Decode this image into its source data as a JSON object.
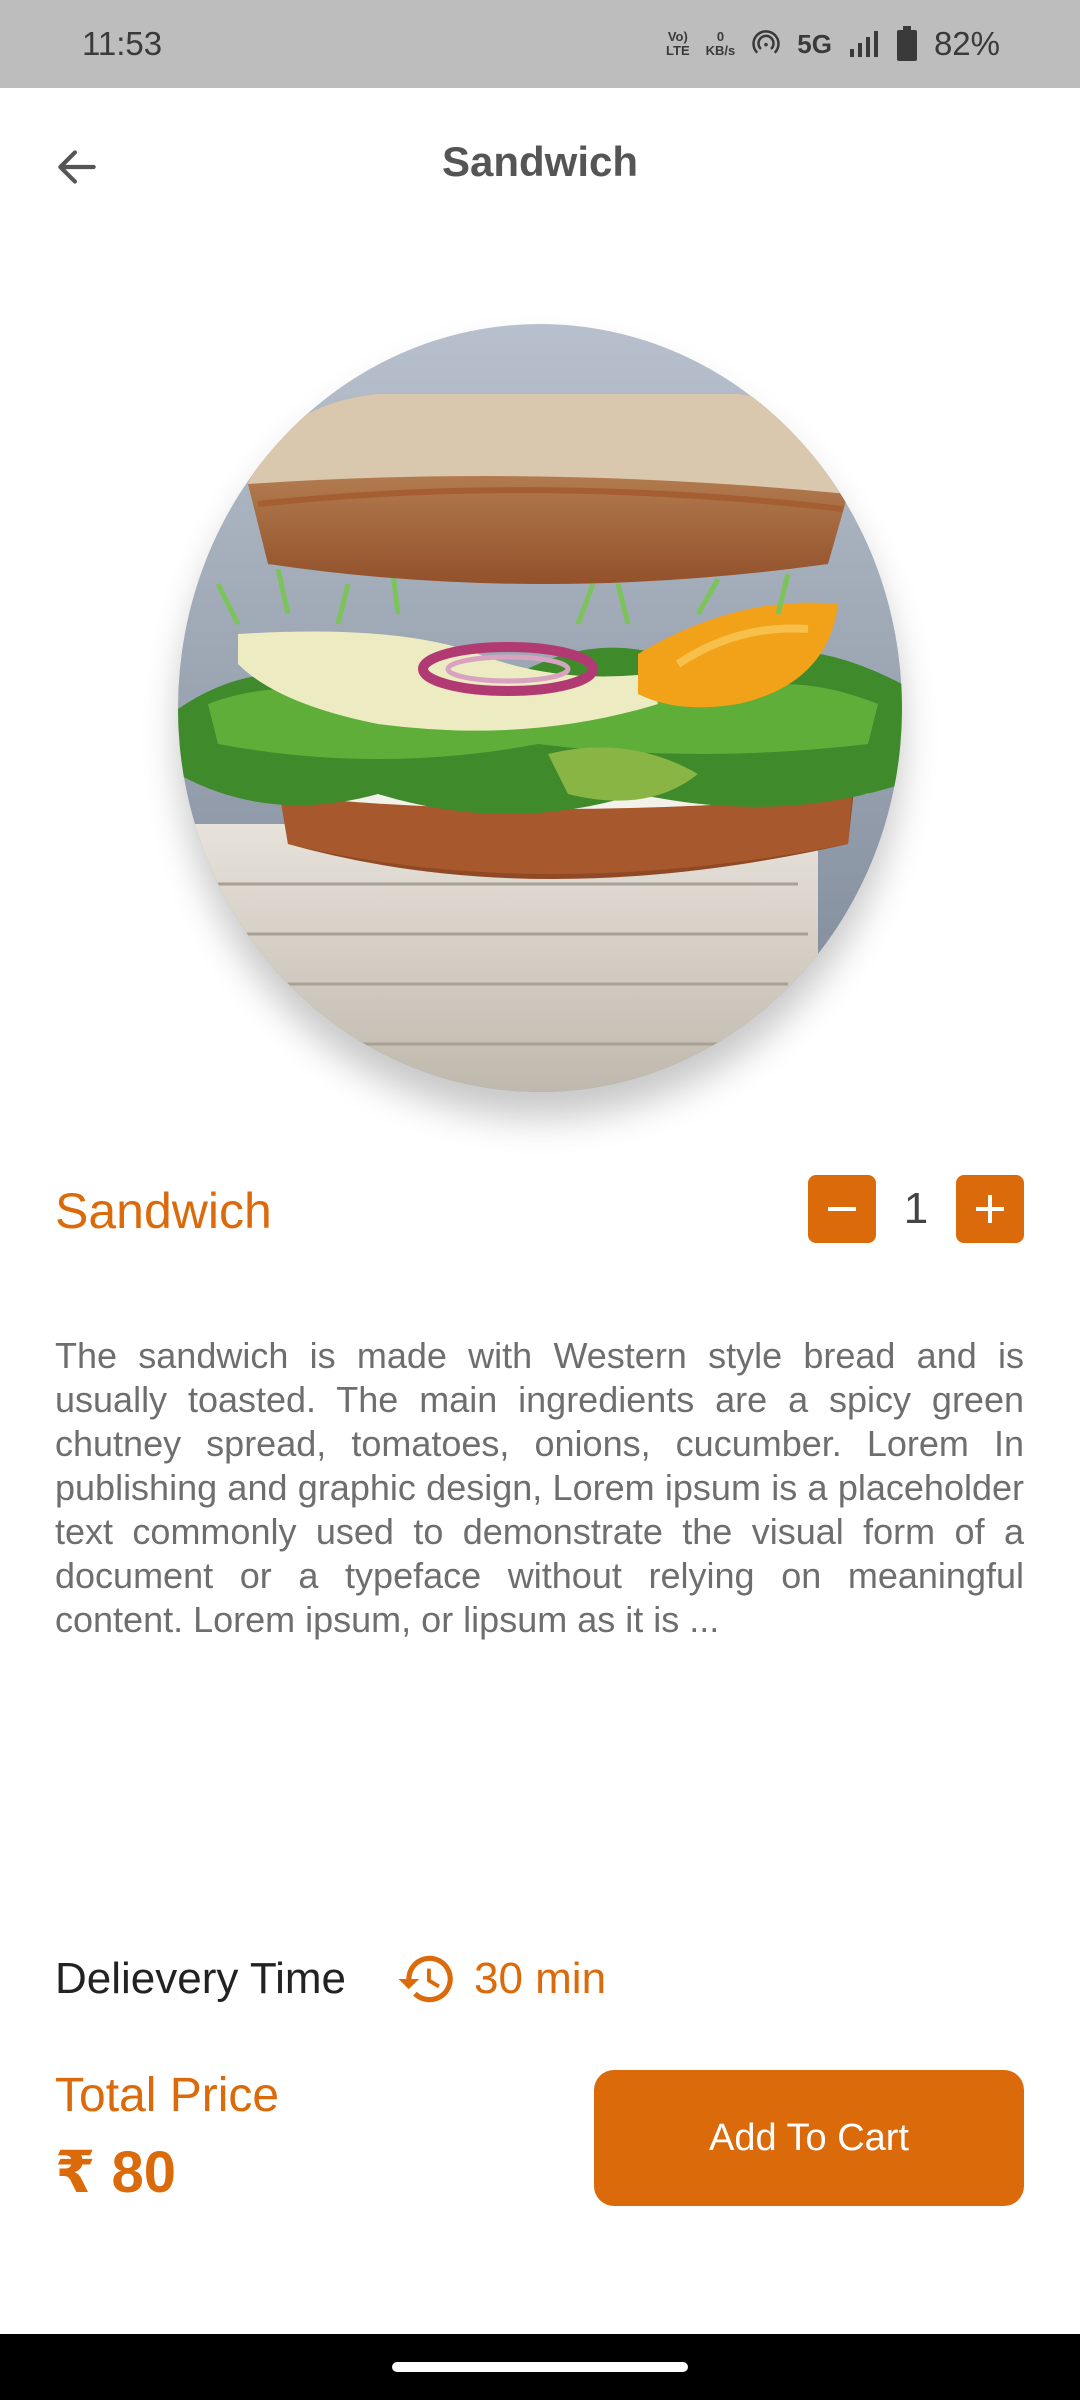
{
  "status_bar": {
    "time": "11:53",
    "volte_top": "Vo)",
    "volte_bottom": "LTE",
    "speed_value": "0",
    "speed_unit": "KB/s",
    "network": "5G",
    "battery": "82%"
  },
  "header": {
    "title": "Sandwich"
  },
  "product": {
    "name": "Sandwich",
    "quantity": "1",
    "description": "The sandwich is made with Western style bread and is usually toasted. The main ingredients are a spicy green chutney spread, tomatoes, onions, cucumber. Lorem In publishing and graphic design, Lorem ipsum is a placeholder text commonly used to demonstrate the visual form of a document or a typeface without relying on meaningful content. Lorem ipsum, or lipsum as it is ..."
  },
  "delivery": {
    "label": "Delievery Time",
    "value": "30 min"
  },
  "total": {
    "label": "Total Price",
    "price": "₹ 80"
  },
  "actions": {
    "add_to_cart": "Add To Cart"
  },
  "colors": {
    "accent": "#db6a0b",
    "status_bar": "#bdbdbd"
  },
  "icons": {
    "back": "arrow-left-icon",
    "minus": "minus-icon",
    "plus": "plus-icon",
    "delivery": "history-clock-icon"
  }
}
